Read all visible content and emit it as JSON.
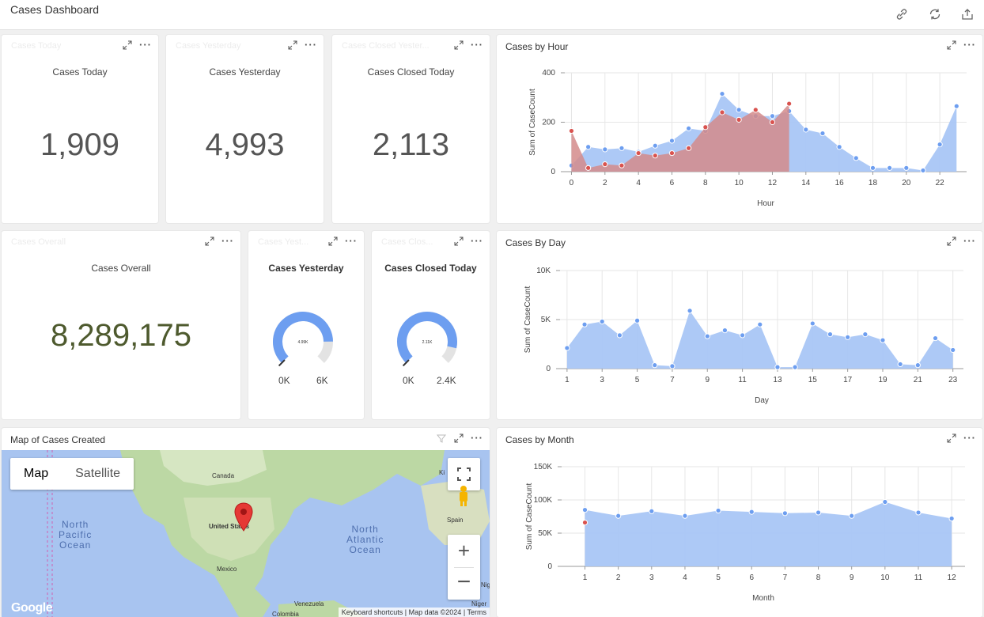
{
  "app": {
    "title": "Cases Dashboard"
  },
  "toolbar": {
    "icons": [
      "link-icon",
      "refresh-icon",
      "export-icon"
    ]
  },
  "cards": {
    "cases_today": {
      "ghost": "Cases Today",
      "subtitle": "Cases Today",
      "value": "1,909"
    },
    "cases_yesterday": {
      "ghost": "Cases Yesterday",
      "subtitle": "Cases Yesterday",
      "value": "4,993"
    },
    "cases_closed_today": {
      "ghost": "Cases Closed Yester...",
      "subtitle": "Cases Closed Today",
      "value": "2,113"
    },
    "cases_overall": {
      "ghost": "Cases Overall",
      "subtitle": "Cases Overall",
      "value": "8,289,175"
    },
    "gauge_yesterday": {
      "ghost": "Cases Yest...",
      "title": "Cases Yesterday",
      "center": "4.99K",
      "min": "0K",
      "max": "6K",
      "fraction": 0.832
    },
    "gauge_closed": {
      "ghost": "Cases Clos...",
      "title": "Cases Closed Today",
      "center": "2.11K",
      "min": "0K",
      "max": "2.4K",
      "fraction": 0.88
    }
  },
  "map": {
    "title": "Map of Cases Created",
    "map_button": "Map",
    "satellite_button": "Satellite",
    "labels": {
      "canada": "Canada",
      "us": "United States",
      "mexico": "Mexico",
      "spain": "Spain",
      "venezuela": "Venezuela",
      "colombia": "Colombia",
      "niger": "Niger",
      "nig": "Nig",
      "ki": "Ki"
    },
    "ocean_pacific": "North\nPacific\nOcean",
    "ocean_atlantic": "North\nAtlantic\nOcean",
    "attribution": {
      "shortcuts": "Keyboard shortcuts",
      "data": "Map data ©2024",
      "terms": "Terms"
    },
    "logo": "Google"
  },
  "chart_data": [
    {
      "id": "hour",
      "type": "area",
      "title": "Cases by Hour",
      "xlabel": "Hour",
      "ylabel": "Sum of CaseCount",
      "ylim": [
        0,
        400
      ],
      "yticks": [
        "0",
        "200",
        "400"
      ],
      "xticks": [
        "0",
        "2",
        "4",
        "6",
        "8",
        "10",
        "12",
        "14",
        "16",
        "18",
        "20",
        "22"
      ],
      "series": [
        {
          "color": "#a9c6f5",
          "x": [
            0,
            1,
            2,
            3,
            4,
            5,
            6,
            7,
            8,
            9,
            10,
            11,
            12,
            13,
            14,
            15,
            16,
            17,
            18,
            19,
            20,
            21,
            22,
            23
          ],
          "values": [
            25,
            100,
            90,
            95,
            80,
            105,
            125,
            175,
            165,
            315,
            250,
            225,
            225,
            245,
            170,
            155,
            100,
            55,
            15,
            15,
            15,
            5,
            110,
            265
          ]
        },
        {
          "color": "#d38b8b",
          "x": [
            0,
            1,
            2,
            3,
            4,
            5,
            6,
            7,
            8,
            9,
            10,
            11,
            12,
            13
          ],
          "values": [
            165,
            15,
            30,
            25,
            75,
            65,
            75,
            95,
            180,
            240,
            210,
            250,
            200,
            275
          ]
        }
      ]
    },
    {
      "id": "day",
      "type": "area",
      "title": "Cases By Day",
      "xlabel": "Day",
      "ylabel": "Sum of CaseCount",
      "ylim": [
        0,
        10000
      ],
      "yticks": [
        "0",
        "5K",
        "10K"
      ],
      "xticks": [
        "1",
        "3",
        "5",
        "7",
        "9",
        "11",
        "13",
        "15",
        "17",
        "19",
        "21",
        "23"
      ],
      "series": [
        {
          "color": "#a9c6f5",
          "x": [
            1,
            2,
            3,
            4,
            5,
            6,
            7,
            8,
            9,
            10,
            11,
            12,
            13,
            14,
            15,
            16,
            17,
            18,
            19,
            20,
            21,
            22,
            23
          ],
          "values": [
            2100,
            4500,
            4800,
            3400,
            4900,
            350,
            250,
            5900,
            3300,
            3900,
            3400,
            4500,
            150,
            150,
            4600,
            3500,
            3200,
            3500,
            2900,
            450,
            350,
            3100,
            1900
          ]
        }
      ]
    },
    {
      "id": "month",
      "type": "area",
      "title": "Cases by Month",
      "xlabel": "Month",
      "ylabel": "Sum of CaseCount",
      "ylim": [
        0,
        150000
      ],
      "yticks": [
        "0",
        "50K",
        "100K",
        "150K"
      ],
      "xticks": [
        "1",
        "2",
        "3",
        "4",
        "5",
        "6",
        "7",
        "8",
        "9",
        "10",
        "11",
        "12"
      ],
      "series": [
        {
          "color": "#a9c6f5",
          "x": [
            1,
            2,
            3,
            4,
            5,
            6,
            7,
            8,
            9,
            10,
            11,
            12
          ],
          "values": [
            85000,
            76000,
            83000,
            76000,
            84000,
            82000,
            80000,
            81000,
            76000,
            97000,
            81000,
            72000
          ]
        },
        {
          "color": "#d38b8b",
          "x": [
            1
          ],
          "values": [
            66000
          ]
        }
      ]
    }
  ]
}
